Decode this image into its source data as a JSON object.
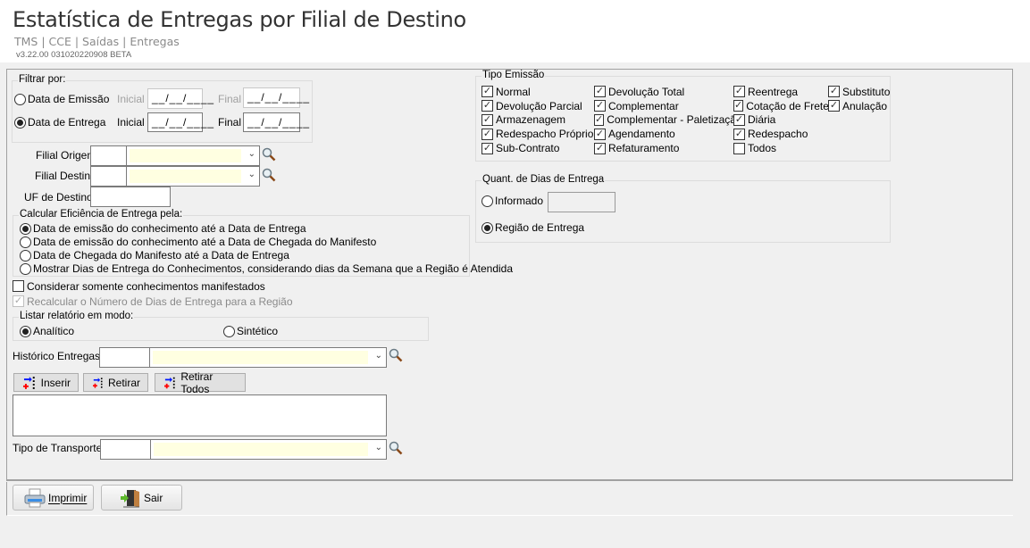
{
  "header": {
    "title": "Estatística de Entregas por Filial de Destino",
    "breadcrumb": "TMS | CCE | Saídas | Entregas",
    "version": "v3.22.00 031020220908 BETA"
  },
  "filtrar": {
    "legend": "Filtrar por:",
    "emissao_label": "Data de Emissão",
    "entrega_label": "Data de Entrega",
    "inicial": "Inicial",
    "final": "Final",
    "emissao_inicial": "__/__/____",
    "emissao_final": "__/__/____",
    "entrega_inicial": "__/__/____",
    "entrega_final": "__/__/____",
    "selected": "Data de Entrega"
  },
  "filial_origem": {
    "label": "Filial Origem",
    "code": "",
    "name": ""
  },
  "filial_destino": {
    "label": "Filial Destino",
    "code": "",
    "name": ""
  },
  "uf_destino": {
    "label": "UF de Destino",
    "value": ""
  },
  "eficiencia": {
    "legend": "Calcular Eficiência de Entrega pela:",
    "options": [
      "Data de emissão do conhecimento até a Data de Entrega",
      "Data de emissão do conhecimento até a Data de Chegada do Manifesto",
      "Data de Chegada do Manifesto até a Data de Entrega",
      "Mostrar Dias de Entrega do Conhecimentos, considerando dias da Semana que a Região é Atendida"
    ],
    "selected_index": 0
  },
  "considerar": {
    "label": "Considerar somente conhecimentos manifestados",
    "checked": false
  },
  "recalcular": {
    "label": "Recalcular o Número de Dias de Entrega para a Região",
    "checked": true,
    "disabled": true
  },
  "listar": {
    "legend": "Listar relatório em modo:",
    "analitico": "Analítico",
    "sintetico": "Sintético",
    "selected": "Analítico"
  },
  "historico": {
    "label": "Histórico Entregas",
    "code": "",
    "name": ""
  },
  "list_buttons": {
    "inserir": "Inserir",
    "retirar": "Retirar",
    "retirar_todos": "Retirar Todos"
  },
  "tipo_transporte": {
    "label": "Tipo de Transporte",
    "code": "",
    "name": ""
  },
  "tipo_emissao": {
    "legend": "Tipo Emissão",
    "items": [
      {
        "label": "Normal",
        "checked": true
      },
      {
        "label": "Devolução Parcial",
        "checked": true
      },
      {
        "label": "Armazenagem",
        "checked": true
      },
      {
        "label": "Redespacho Próprio",
        "checked": true
      },
      {
        "label": "Sub-Contrato",
        "checked": true
      },
      {
        "label": "Devolução Total",
        "checked": true
      },
      {
        "label": "Complementar",
        "checked": true
      },
      {
        "label": "Complementar - Paletização",
        "checked": true
      },
      {
        "label": "Agendamento",
        "checked": true
      },
      {
        "label": "Refaturamento",
        "checked": true
      },
      {
        "label": "Reentrega",
        "checked": true
      },
      {
        "label": "Cotação de Frete",
        "checked": true
      },
      {
        "label": "Diária",
        "checked": true
      },
      {
        "label": "Redespacho",
        "checked": true
      },
      {
        "label": "Todos",
        "checked": false
      },
      {
        "label": "Substituto",
        "checked": true
      },
      {
        "label": "Anulação",
        "checked": true
      }
    ]
  },
  "quant_dias": {
    "legend": "Quant. de Dias de Entrega",
    "informado": "Informado",
    "informado_value": "",
    "regiao": "Região de Entrega",
    "selected": "Região de Entrega"
  },
  "footer": {
    "imprimir": "Imprimir",
    "sair": "Sair"
  }
}
